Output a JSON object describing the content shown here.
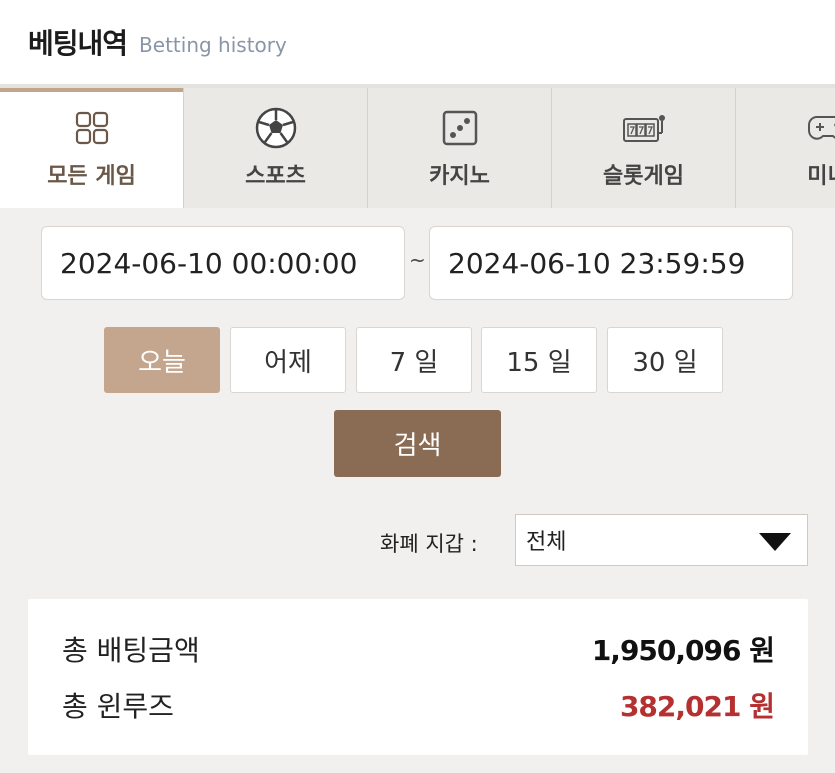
{
  "header": {
    "title": "베팅내역",
    "subtitle": "Betting history"
  },
  "tabs": [
    {
      "label": "모든 게임",
      "icon": "grid-icon",
      "active": true
    },
    {
      "label": "스포츠",
      "icon": "soccer-ball-icon",
      "active": false
    },
    {
      "label": "카지노",
      "icon": "dice-icon",
      "active": false
    },
    {
      "label": "슬롯게임",
      "icon": "slot-machine-icon",
      "active": false
    },
    {
      "label": "미니",
      "icon": "gamepad-icon",
      "active": false
    }
  ],
  "date_range": {
    "start": "2024-06-10 00:00:00",
    "separator": "~",
    "end": "2024-06-10 23:59:59"
  },
  "quick_ranges": [
    "오늘",
    "어제",
    "7 일",
    "15 일",
    "30 일"
  ],
  "search_label": "검색",
  "wallet": {
    "label": "화폐 지갑 :",
    "selected": "전체"
  },
  "summary": {
    "total_bet_label": "총 배팅금액",
    "total_bet_value": "1,950,096 원",
    "total_winloss_label": "총 윈루즈",
    "total_winloss_value": "382,021 원"
  },
  "colors": {
    "accent": "#c4a68e",
    "search_button": "#8a6c54",
    "negative_value": "#b53030"
  }
}
